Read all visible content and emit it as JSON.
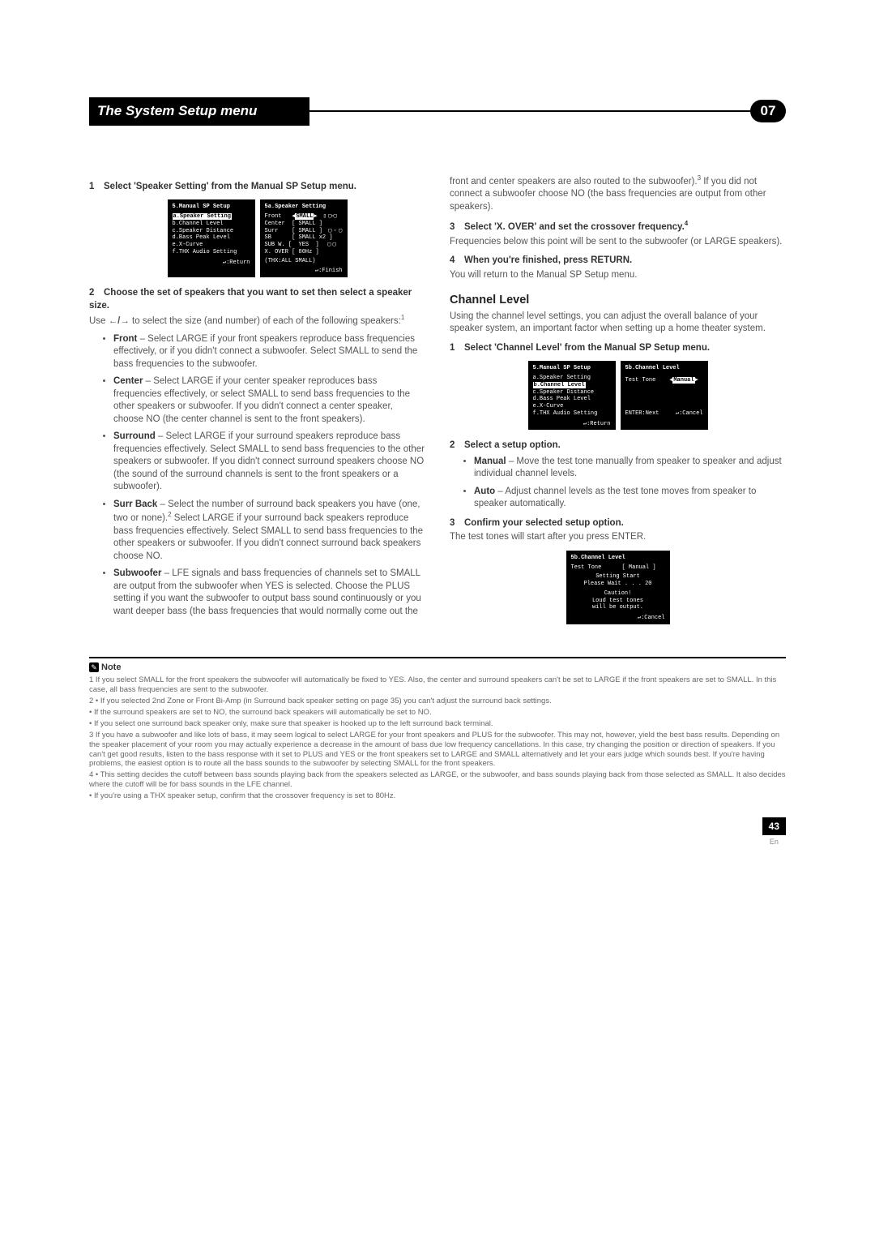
{
  "header": {
    "title": "The System Setup menu",
    "chapter": "07"
  },
  "left": {
    "step1": "Select 'Speaker Setting' from the Manual SP Setup menu.",
    "step2": "Choose the set of speakers that you want to set then select a speaker size.",
    "step2_body_a": "Use ",
    "step2_body_b": " to select the size (and number) of each of the following speakers:",
    "sup1": "1",
    "front_label": "Front",
    "front_text": " – Select LARGE if your front speakers reproduce bass frequencies effectively, or if you didn't connect a subwoofer. Select SMALL to send the bass frequencies to the subwoofer.",
    "center_label": "Center",
    "center_text": " – Select LARGE if your center speaker reproduces bass frequencies effectively, or select SMALL to send bass frequencies to the other speakers or subwoofer. If you didn't connect a center speaker, choose NO (the center channel is sent to the front speakers).",
    "surround_label": "Surround",
    "surround_text": " – Select LARGE if your surround speakers reproduce bass frequencies effectively. Select SMALL to send bass frequencies to the other speakers or subwoofer. If you didn't connect surround speakers choose NO (the sound of the surround channels is sent to the front speakers or a subwoofer).",
    "surrback_label": "Surr Back",
    "surrback_text_a": " – Select the number of surround back speakers you have (one, two or none).",
    "sup2": "2",
    "surrback_text_b": " Select LARGE if your surround back speakers reproduce bass frequencies effectively. Select SMALL to send bass frequencies to the other speakers or subwoofer. If you didn't connect surround back speakers choose NO.",
    "sub_label": "Subwoofer",
    "sub_text": " – LFE signals and bass frequencies of channels set to SMALL are output from the subwoofer when YES is selected. Choose the PLUS setting if you want the subwoofer to output bass sound continuously or you want deeper bass (the bass frequencies that would normally come out the"
  },
  "right": {
    "cont_a": "front and center speakers are also routed to the subwoofer).",
    "sup3": "3",
    "cont_b": " If you did not connect a subwoofer choose NO (the bass frequencies are output from other speakers).",
    "step3": "Select 'X. OVER' and set the crossover frequency.",
    "sup4": "4",
    "step3_body": "Frequencies below this point will be sent to the subwoofer (or LARGE speakers).",
    "step4": "When you're finished, press RETURN.",
    "step4_body": "You will return to the Manual SP Setup menu.",
    "channel_level": "Channel Level",
    "cl_intro": "Using the channel level settings, you can adjust the overall balance of your speaker system, an important factor when setting up a home theater system.",
    "cl_step1": "Select 'Channel Level' from the Manual SP Setup menu.",
    "cl_step2": "Select a setup option.",
    "cl_manual_label": "Manual",
    "cl_manual_text": " – Move the test tone manually from speaker to speaker and adjust individual channel levels.",
    "cl_auto_label": "Auto",
    "cl_auto_text": " – Adjust channel levels as the test tone moves from speaker to speaker automatically.",
    "cl_step3": "Confirm your selected setup option.",
    "cl_step3_body": "The test tones will start after you press ENTER."
  },
  "osd": {
    "menu_title": "5.Manual  SP  Setup",
    "menu_a": "a.Speaker  Setting",
    "menu_b": "b.Channel  Level",
    "menu_c": "c.Speaker  Distance",
    "menu_d": "d.Bass  Peak  Level",
    "menu_e": "e.X-Curve",
    "menu_f": "f.THX  Audio  Setting",
    "return": ":Return",
    "spk_title": "5a.Speaker  Setting",
    "spk_front": "Front",
    "spk_center": "Center",
    "spk_surr": "Surr",
    "spk_sb": "SB",
    "spk_subw": "SUB W.",
    "spk_small": "SMALL",
    "spk_smallx2": "SMALL x2",
    "spk_yes": "YES",
    "spk_xover": "X. OVER [   80Hz  ]",
    "spk_thx": "(THX:ALL  SMALL)",
    "finish": ":Finish",
    "cl_title": "5b.Channel  Level",
    "cl_testtone": "Test  Tone",
    "cl_manual": "Manual",
    "cl_enter": "ENTER:Next",
    "cl_cancel": ":Cancel",
    "cl2_setting": "Setting  Start",
    "cl2_wait": "Please  Wait . . .      20",
    "cl2_caution": "Caution!",
    "cl2_loud": "Loud  test  tones",
    "cl2_output": "will  be  output."
  },
  "notes": {
    "label": "Note",
    "n1": "1  If you select SMALL for the front speakers the subwoofer will automatically be fixed to YES. Also, the center and surround speakers can't be set to LARGE if the front speakers are set to SMALL. In this case, all bass frequencies are sent to the subwoofer.",
    "n2a": "2 • If you selected 2nd Zone or Front Bi-Amp (in Surround back speaker setting on page 35) you can't adjust the surround back settings.",
    "n2b": "• If the surround speakers are set to NO, the surround back speakers will automatically be set to NO.",
    "n2c": "• If you select one surround back speaker only, make sure that speaker is hooked up to the left surround back terminal.",
    "n3": "3 If you have a subwoofer and like lots of bass, it may seem logical to select LARGE for your front speakers and PLUS for the subwoofer. This may not, however, yield the best bass results. Depending on the speaker placement of your room you may actually experience a decrease in the amount of bass due low frequency cancellations. In this case, try changing the position or direction of speakers. If you can't get good results, listen to the bass response with it set to PLUS and YES or the front speakers set to LARGE and SMALL alternatively and let your ears judge which sounds best. If you're having problems, the easiest option is to route all the bass sounds to the subwoofer by selecting SMALL for the front speakers.",
    "n4a": "4 • This setting decides the cutoff between bass sounds playing back from the speakers selected as LARGE, or the subwoofer, and bass sounds playing back from those selected as SMALL. It also decides where the cutoff will be for bass sounds in the LFE channel.",
    "n4b": "• If you're using a THX speaker setup, confirm that the crossover frequency is set to 80Hz."
  },
  "page": {
    "num": "43",
    "lang": "En"
  }
}
